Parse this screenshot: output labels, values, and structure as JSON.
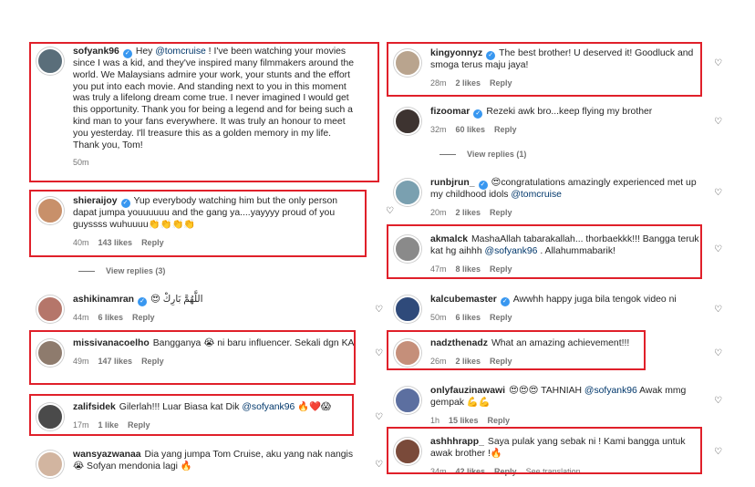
{
  "left": {
    "comments": [
      {
        "user": "sofyank96",
        "verified": true,
        "text_pre": "Hey ",
        "mention": "@tomcruise",
        "text_post": " ! I've been watching your movies since I was a kid, and they've inspired many filmmakers around the world. We Malaysians admire your work, your stunts and the effort you put into each movie. And standing next to you in this moment was truly a lifelong dream come true. I never imagined I would get this opportunity. Thank you for being a legend and for being such a kind man to your fans everywhere. It was truly an honour to meet you yesterday. I'll treasure this as a golden memory in my life. Thank you, Tom!",
        "time": "50m",
        "likes": "",
        "reply": ""
      },
      {
        "user": "shieraijoy",
        "verified": true,
        "text_pre": "Yup everybody watching him but the only person dapat jumpa youuuuuu and the gang ya....yayyyy proud of you guyssss wuhuuuu👏👏👏👏",
        "time": "40m",
        "likes": "143 likes",
        "reply": "Reply"
      },
      {
        "user": "ashikinamran",
        "verified": true,
        "text_pre": "😍 اللَّهُمَّ بَارِكْ",
        "time": "44m",
        "likes": "6 likes",
        "reply": "Reply"
      },
      {
        "user": "missivanacoelho",
        "text_pre": "Bangganya 😭 ni baru influencer. Sekali dgn KA",
        "time": "49m",
        "likes": "147 likes",
        "reply": "Reply"
      },
      {
        "user": "zalifsidek",
        "text_pre": "Gilerlah!!! Luar Biasa kat Dik ",
        "mention": "@sofyank96",
        "text_post": " 🔥❤️😱",
        "time": "17m",
        "likes": "1 like",
        "reply": "Reply"
      },
      {
        "user": "wansyazwanaa",
        "text_pre": "Dia yang jumpa Tom Cruise, aku yang nak nangis 😭 Sofyan mendonia lagi 🔥",
        "time": "",
        "likes": "",
        "reply": ""
      }
    ],
    "view_replies": "View replies (3)"
  },
  "right": {
    "comments": [
      {
        "user": "kingyonnyz",
        "verified": true,
        "text_pre": "The best brother! U deserved it! Goodluck and smoga terus maju jaya!",
        "time": "28m",
        "likes": "2 likes",
        "reply": "Reply"
      },
      {
        "user": "fizoomar",
        "verified": true,
        "text_pre": "Rezeki awk bro...keep flying my brother",
        "time": "32m",
        "likes": "60 likes",
        "reply": "Reply"
      },
      {
        "user": "runbjrun_",
        "verified": true,
        "text_pre": "😍congratulations amazingly experienced met up my childhood idols ",
        "mention": "@tomcruise",
        "time": "20m",
        "likes": "2 likes",
        "reply": "Reply"
      },
      {
        "user": "akmalck",
        "text_pre": "MashaAllah tabarakallah... thorbaekkk!!! Bangga teruk kat hg aihhh ",
        "mention": "@sofyank96",
        "text_post": " . Allahummabarik!",
        "time": "47m",
        "likes": "8 likes",
        "reply": "Reply"
      },
      {
        "user": "kalcubemaster",
        "verified": true,
        "text_pre": "Awwhh happy juga bila tengok video ni",
        "time": "50m",
        "likes": "6 likes",
        "reply": "Reply"
      },
      {
        "user": "nadzthenadz",
        "text_pre": "What an amazing achievement!!!",
        "time": "26m",
        "likes": "2 likes",
        "reply": "Reply"
      },
      {
        "user": "onlyfauzinawawi",
        "text_pre": "😍😍😍 TAHNIAH ",
        "mention": "@sofyank96",
        "text_post": " Awak mmg gempak 💪💪",
        "time": "1h",
        "likes": "15 likes",
        "reply": "Reply"
      },
      {
        "user": "ashhhrapp_",
        "text_pre": "Saya pulak yang sebak ni ! Kami bangga untuk awak brother !🔥",
        "time": "34m",
        "likes": "42 likes",
        "reply": "Reply",
        "extra": "See translation"
      }
    ],
    "view_replies": "View replies (1)"
  },
  "heart_icon": "♡"
}
